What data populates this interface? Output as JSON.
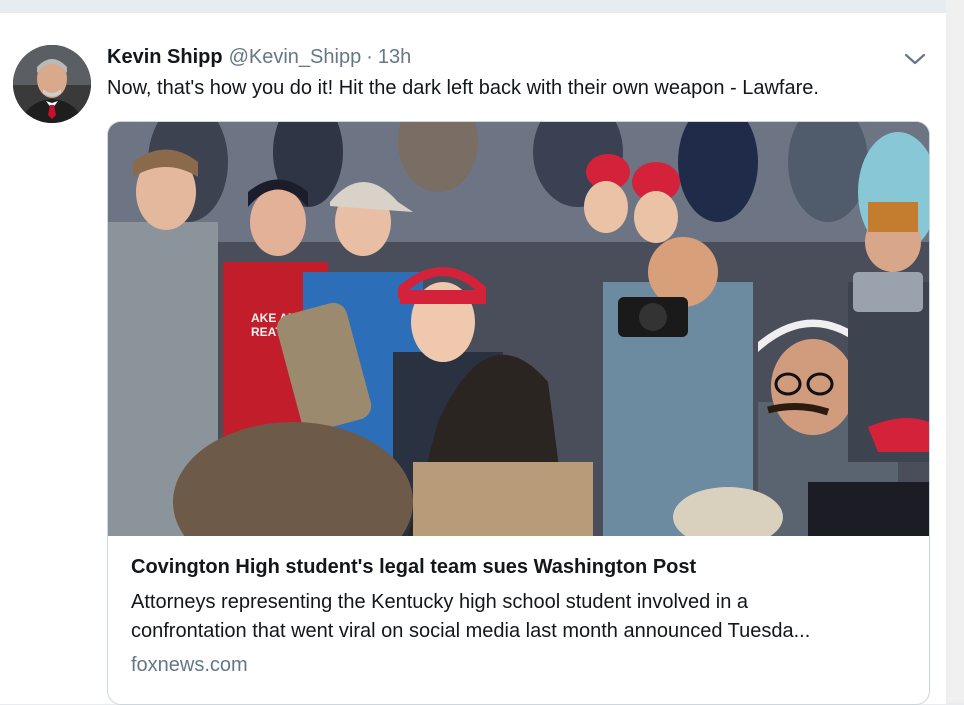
{
  "tweet": {
    "author_name": "Kevin Shipp",
    "handle": "@Kevin_Shipp",
    "separator": "·",
    "time": "13h",
    "text": "Now, that's how you do it! Hit the dark left back with their own weapon - Lawfare."
  },
  "card": {
    "title": "Covington High student's legal team sues Washington Post",
    "description_line1": "Attorneys representing the Kentucky high school student involved in a",
    "description_line2": "confrontation that went viral on social media last month announced Tuesda...",
    "domain": "foxnews.com",
    "image_cap_text_1": "AKE AM",
    "image_cap_text_2": "REAT"
  },
  "icons": {
    "caret": "chevron-down-icon",
    "avatar": "avatar"
  },
  "colors": {
    "primary_text": "#14171a",
    "secondary_text": "#657786",
    "border": "#ccd6dd",
    "background": "#e6ecf0",
    "maga_red": "#d3223a"
  }
}
